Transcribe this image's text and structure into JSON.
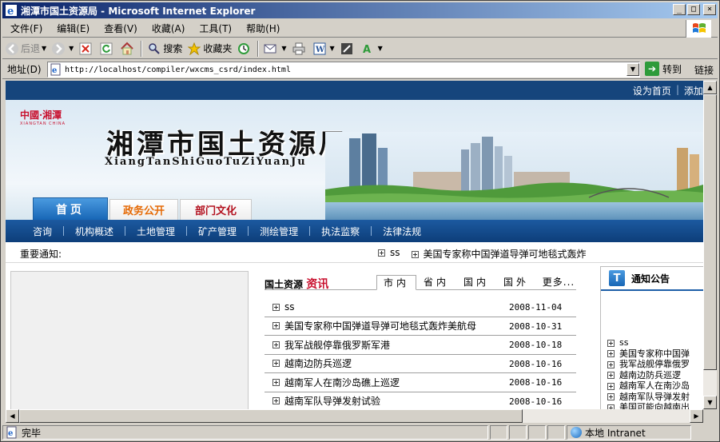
{
  "window": {
    "title": "湘潭市国土资源局 - Microsoft Internet Explorer",
    "min": "_",
    "max": "□",
    "close": "×"
  },
  "menu": [
    "文件(F)",
    "编辑(E)",
    "查看(V)",
    "收藏(A)",
    "工具(T)",
    "帮助(H)"
  ],
  "toolbar": {
    "back": "后退",
    "search": "搜索",
    "favorites": "收藏夹"
  },
  "address": {
    "label": "地址(D)",
    "url": "http://localhost/compiler/wxcms_csrd/index.html",
    "go": "转到",
    "links": "链接"
  },
  "status": {
    "text": "完毕",
    "zone": "本地 Intranet"
  },
  "page": {
    "top_links": [
      "设为首页",
      "添加"
    ],
    "logo_cn": "中國·湘潭",
    "logo_en": "XIANGTAN  CHINA",
    "site_title": "湘潭市国土资源局",
    "site_pinyin": "XiangTanShiGuoTuZiYuanJu",
    "tabs": [
      "首页",
      "政务公开",
      "部门文化"
    ],
    "nav": [
      "咨询",
      "机构概述",
      "土地管理",
      "矿产管理",
      "测绘管理",
      "执法监察",
      "法律法规"
    ],
    "notice_label": "重要通知:",
    "ticker": [
      "ss",
      "美国专家称中国弹道导弹可地毯式轰炸"
    ],
    "news": {
      "head_a": "国土资源",
      "head_b": "资讯",
      "tabs": [
        "市内",
        "省内",
        "国内",
        "国外",
        "更多..."
      ],
      "rows": [
        {
          "title": "ss",
          "date": "2008-11-04"
        },
        {
          "title": "美国专家称中国弹道导弹可地毯式轰炸美航母",
          "date": "2008-10-31"
        },
        {
          "title": "我军战舰停靠俄罗斯军港",
          "date": "2008-10-18"
        },
        {
          "title": "越南边防兵巡逻",
          "date": "2008-10-16"
        },
        {
          "title": "越南军人在南沙岛礁上巡逻",
          "date": "2008-10-16"
        },
        {
          "title": "越南军队导弹发射试验",
          "date": "2008-10-16"
        }
      ]
    },
    "notice_box": {
      "badge": "T",
      "title": "通知公告",
      "items": [
        "ss",
        "美国专家称中国弹",
        "我军战舰停靠俄罗",
        "越南边防兵巡逻",
        "越南军人在南沙岛",
        "越南军队导弹发射",
        "美国可能向越南出"
      ]
    }
  },
  "colors": {
    "title_bar": "#0a246a",
    "nav_blue": "#15457c",
    "tab_orange": "#e56a06",
    "tab_red": "#b3101e",
    "accent_red": "#c8102e"
  }
}
